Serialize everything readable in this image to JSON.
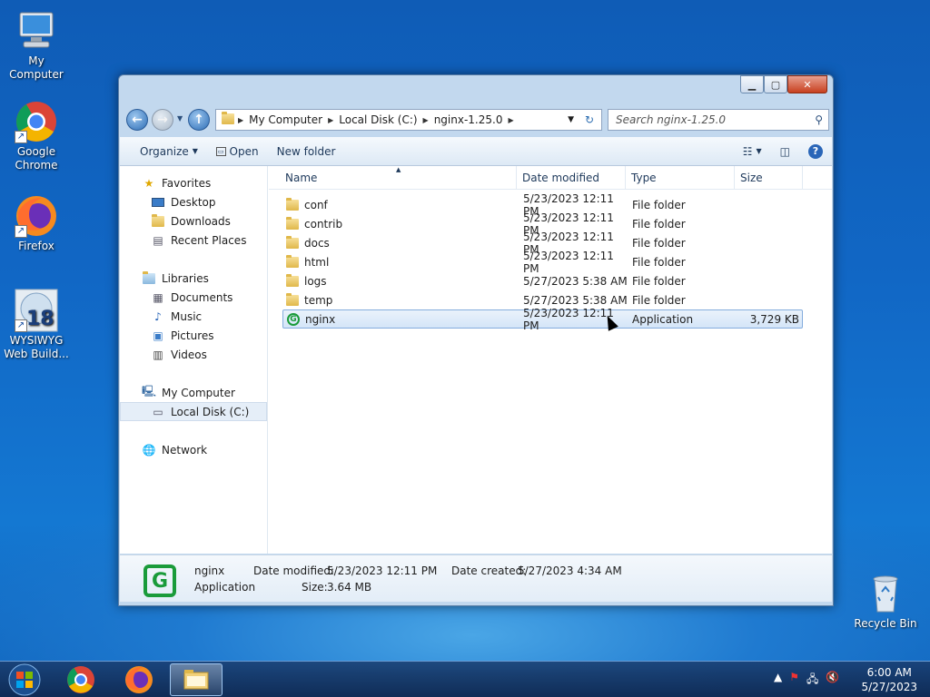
{
  "desktop": {
    "icons": [
      {
        "label": "My Computer"
      },
      {
        "label": "Google Chrome"
      },
      {
        "label": "Firefox"
      },
      {
        "label": "WYSIWYG Web Build..."
      },
      {
        "label": "Recycle Bin"
      }
    ]
  },
  "window": {
    "address": {
      "crumbs": [
        "My Computer",
        "Local Disk (C:)",
        "nginx-1.25.0"
      ]
    },
    "search_placeholder": "Search nginx-1.25.0",
    "toolbar": {
      "organize": "Organize",
      "open": "Open",
      "new_folder": "New folder"
    },
    "nav": {
      "favorites": "Favorites",
      "favorites_items": [
        "Desktop",
        "Downloads",
        "Recent Places"
      ],
      "libraries": "Libraries",
      "libraries_items": [
        "Documents",
        "Music",
        "Pictures",
        "Videos"
      ],
      "computer": "My Computer",
      "computer_items": [
        "Local Disk (C:)"
      ],
      "network": "Network"
    },
    "columns": {
      "name": "Name",
      "date": "Date modified",
      "type": "Type",
      "size": "Size"
    },
    "files": [
      {
        "name": "conf",
        "date": "5/23/2023 12:11 PM",
        "type": "File folder",
        "size": "",
        "kind": "folder"
      },
      {
        "name": "contrib",
        "date": "5/23/2023 12:11 PM",
        "type": "File folder",
        "size": "",
        "kind": "folder"
      },
      {
        "name": "docs",
        "date": "5/23/2023 12:11 PM",
        "type": "File folder",
        "size": "",
        "kind": "folder"
      },
      {
        "name": "html",
        "date": "5/23/2023 12:11 PM",
        "type": "File folder",
        "size": "",
        "kind": "folder"
      },
      {
        "name": "logs",
        "date": "5/27/2023 5:38 AM",
        "type": "File folder",
        "size": "",
        "kind": "folder"
      },
      {
        "name": "temp",
        "date": "5/27/2023 5:38 AM",
        "type": "File folder",
        "size": "",
        "kind": "folder"
      },
      {
        "name": "nginx",
        "date": "5/23/2023 12:11 PM",
        "type": "Application",
        "size": "3,729 KB",
        "kind": "app"
      }
    ],
    "details": {
      "name": "nginx",
      "type": "Application",
      "date_modified_label": "Date modified:",
      "date_modified": "5/23/2023 12:11 PM",
      "date_created_label": "Date created:",
      "date_created": "5/27/2023 4:34 AM",
      "size_label": "Size:",
      "size": "3.64 MB"
    }
  },
  "taskbar": {
    "time": "6:00 AM",
    "date": "5/27/2023"
  }
}
